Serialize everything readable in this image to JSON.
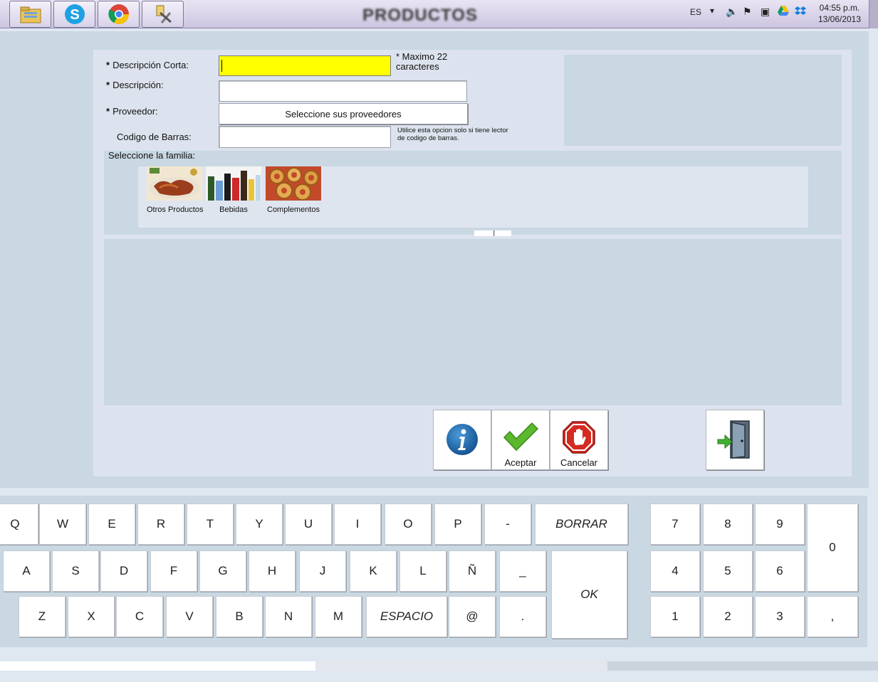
{
  "window": {
    "title": "PRODUCTOS"
  },
  "taskbar": {
    "apps": [
      {
        "name": "explorer-icon"
      },
      {
        "name": "skype-icon"
      },
      {
        "name": "chrome-icon"
      },
      {
        "name": "tools-icon"
      }
    ],
    "language": "ES",
    "time": "04:55 p.m.",
    "date": "13/06/2013"
  },
  "form": {
    "desc_corta_label": "Descripción Corta:",
    "desc_corta_value": "",
    "desc_corta_hint_line1": "* Maximo 22",
    "desc_corta_hint_line2": "caracteres",
    "descripcion_label": "Descripción:",
    "descripcion_value": "",
    "proveedor_label": "Proveedor:",
    "proveedor_button": "Seleccione sus proveedores",
    "codigo_label": "Codigo de Barras:",
    "codigo_value": "",
    "codigo_hint_line1": "Utilice esta opcion solo si tiene lector",
    "codigo_hint_line2": "de codigo de barras.",
    "asterisk": "*",
    "familia_label": "Seleccione la familia:"
  },
  "familias": [
    {
      "label": "Otros Productos"
    },
    {
      "label": "Bebidas"
    },
    {
      "label": "Complementos"
    }
  ],
  "actions": {
    "aceptar": "Aceptar",
    "cancelar": "Cancelar"
  },
  "keyboard": {
    "row1": [
      "Q",
      "W",
      "E",
      "R",
      "T",
      "Y",
      "U",
      "I",
      "O",
      "P",
      "-"
    ],
    "borrar": "BORRAR",
    "row2": [
      "A",
      "S",
      "D",
      "F",
      "G",
      "H",
      "J",
      "K",
      "L",
      "Ñ",
      "_"
    ],
    "ok": "OK",
    "row3": [
      "Z",
      "X",
      "C",
      "V",
      "B",
      "N",
      "M"
    ],
    "espacio": "ESPACIO",
    "row3_end": [
      "@",
      "."
    ],
    "numpad": {
      "r1": [
        "7",
        "8",
        "9"
      ],
      "r2": [
        "4",
        "5",
        "6"
      ],
      "r3": [
        "1",
        "2",
        "3"
      ],
      "zero": "0",
      "comma": ","
    }
  },
  "colors": {
    "highlight_field": "#ffff00",
    "panel": "#c9d8e3",
    "form_bg": "#dde3ee"
  }
}
